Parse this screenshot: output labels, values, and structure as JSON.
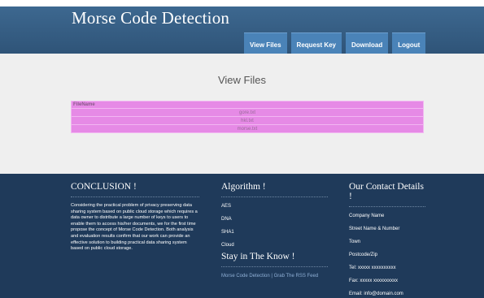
{
  "header": {
    "title": "Morse Code Detection",
    "nav": [
      {
        "label": "View Files"
      },
      {
        "label": "Request Key"
      },
      {
        "label": "Download"
      },
      {
        "label": "Logout"
      }
    ]
  },
  "main": {
    "title": "View Files",
    "table": {
      "header": "FileName",
      "rows": [
        "gore.txt",
        "hkl.txt",
        "morse.txt"
      ]
    }
  },
  "footer": {
    "conclusion": {
      "title": "CONCLUSION !",
      "text": "Considering the practical problem of privacy preserving data sharing system based on public cloud storage which requires a data owner to distribute a large number of keys to users to enable them to access his/her documents, we for the first time propose the concept of Morse Code Detection. Both analysis and evaluation results confirm that our work can provide an effective solution to building practical data sharing system based on public cloud storage."
    },
    "algorithm": {
      "title": "Algorithm !",
      "items": [
        "AES",
        "DNA",
        "SHA1",
        "Cloud"
      ]
    },
    "stay": {
      "title": "Stay in The Know !",
      "link1": "Morse Code Detection",
      "separator": "|",
      "link2": "Grab The RSS Feed"
    },
    "contact": {
      "title": "Our Contact Details !",
      "items": [
        "Company Name",
        "Street Name & Number",
        "Town",
        "Postcode/Zip",
        "Tel: xxxxx xxxxxxxxxx",
        "Fax: xxxxx xxxxxxxxxx",
        "Email: info@domain.com"
      ]
    }
  },
  "colors": {
    "header": "#3a5f86",
    "nav_button": "#4a83b8",
    "content_bg": "#efefef",
    "table_bg": "#e68ae6",
    "footer_bg": "#1f3a5a"
  }
}
